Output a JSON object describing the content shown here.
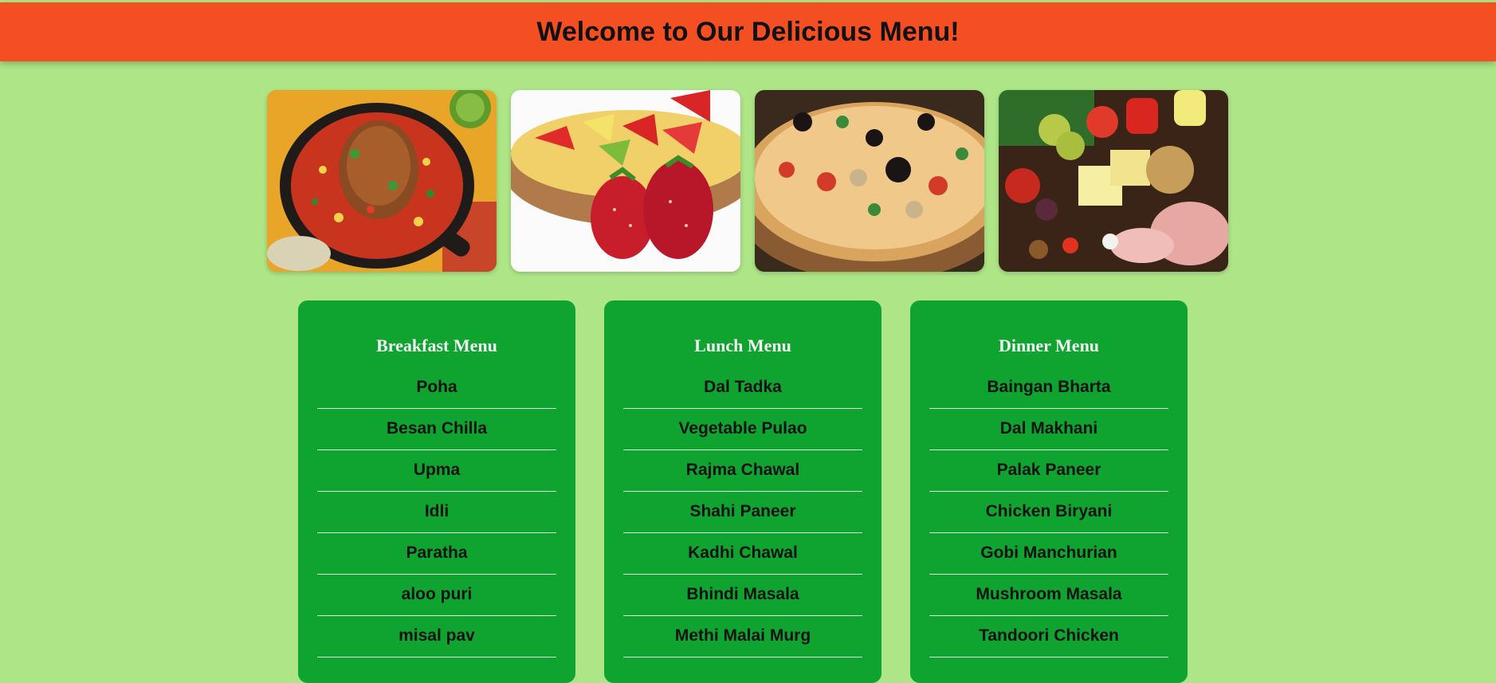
{
  "header": {
    "title": "Welcome to Our Delicious Menu!"
  },
  "gallery": [
    {
      "icon": "roast-chicken-skillet-photo"
    },
    {
      "icon": "strawberry-tart-photo"
    },
    {
      "icon": "pizza-photo"
    },
    {
      "icon": "vegetables-cheese-platter-photo"
    }
  ],
  "menus": [
    {
      "title": "Breakfast Menu",
      "items": [
        "Poha",
        "Besan Chilla",
        "Upma",
        "Idli",
        "Paratha",
        "aloo puri",
        "misal pav"
      ]
    },
    {
      "title": "Lunch Menu",
      "items": [
        "Dal Tadka",
        "Vegetable Pulao",
        "Rajma Chawal",
        "Shahi Paneer",
        "Kadhi Chawal",
        "Bhindi Masala",
        "Methi Malai Murg"
      ]
    },
    {
      "title": "Dinner Menu",
      "items": [
        "Baingan Bharta",
        "Dal Makhani",
        "Palak Paneer",
        "Chicken Biryani",
        "Gobi Manchurian",
        "Mushroom Masala",
        "Tandoori Chicken"
      ]
    }
  ],
  "colors": {
    "page_background": "#aee687",
    "header_background": "#f44f23",
    "card_background": "#0fa430"
  }
}
